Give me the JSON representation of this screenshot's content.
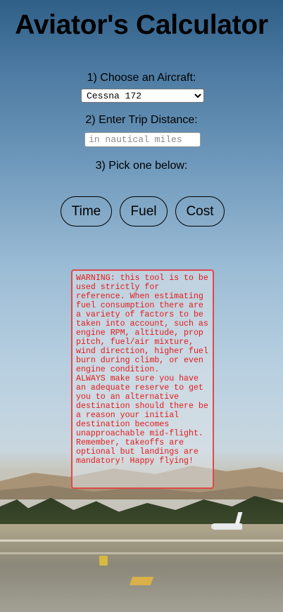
{
  "app": {
    "title": "Aviator's Calculator"
  },
  "steps": {
    "aircraft_label": "1) Choose an Aircraft:",
    "distance_label": "2) Enter Trip Distance:",
    "pick_label": "3) Pick one below:"
  },
  "aircraft_select": {
    "selected": "Cessna 172"
  },
  "distance_input": {
    "value": "",
    "placeholder": "in nautical miles"
  },
  "buttons": {
    "time": "Time",
    "fuel": "Fuel",
    "cost": "Cost"
  },
  "warning": {
    "paragraph1": "WARNING: this tool is to be used strictly for reference. When estimating fuel consumption there are a variety of factors to be taken into account, such as engine RPM, altitude, prop pitch, fuel/air mixture, wind direction, higher fuel burn during climb, or even engine condition.",
    "paragraph2": "ALWAYS make sure you have an adequate reserve to get you to an alternative destination should there be a reason your initial destination becomes unapproachable mid-flight.",
    "paragraph3": "Remember, takeoffs are optional but landings are mandatory! Happy flying!"
  },
  "colors": {
    "warning_text": "#e21a1a",
    "warning_border": "#e0484a",
    "sky_top": "#2f5f86"
  }
}
